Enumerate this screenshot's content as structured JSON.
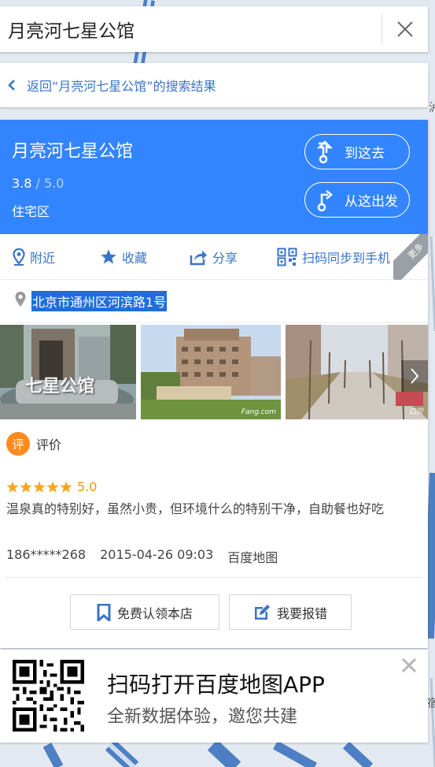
{
  "search": {
    "query": "月亮河七星公馆"
  },
  "back": {
    "label": "返回“月亮河七星公馆”的搜索结果"
  },
  "place": {
    "name": "月亮河七星公馆",
    "rating": "3.8",
    "rating_max": " / 5.0",
    "category": "住宅区",
    "to_here": "到这去",
    "from_here": "从这出发"
  },
  "actions": {
    "nearby": "附近",
    "favorite": "收藏",
    "share": "分享",
    "qr_sync": "扫码同步到手机",
    "more": "更多"
  },
  "address": "北京市通州区河滨路1号",
  "photos": {
    "watermark_2": "Fang.com",
    "watermark_3": "口贝",
    "sign_text": "七星公馆"
  },
  "review": {
    "badge": "评",
    "title": "评价",
    "stars": 5,
    "score": "5.0",
    "text": "温泉真的特别好，虽然小贵，但环境什么的特别干净，自助餐也好吃",
    "user": "186*****268",
    "date": "2015-04-26 09:03",
    "source": "百度地图"
  },
  "buttons": {
    "claim": "免费认领本店",
    "report": "我要报错"
  },
  "banner": {
    "line1": "扫码打开百度地图APP",
    "line2": "全新数据体验，邀您共建"
  },
  "map_labels": {
    "edge_1": "泸",
    "edge_2": "宿"
  },
  "colors": {
    "accent": "#3385ff",
    "link": "#3a74c8",
    "star": "#f39800",
    "badge": "#ff8a1f"
  }
}
